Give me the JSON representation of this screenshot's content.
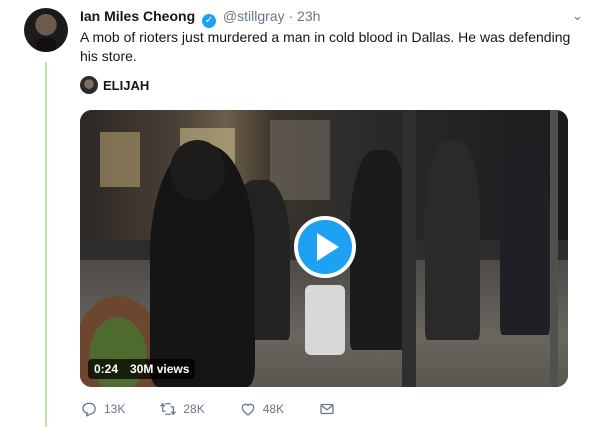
{
  "tweet": {
    "author_name": "Ian Miles Cheong",
    "handle": "@stillgray",
    "separator": "·",
    "time": "23h",
    "text": "A mob of rioters just murdered a man  in cold blood in Dallas. He was defending his store.",
    "attribution_name": "ELIJAH",
    "video": {
      "duration": "0:24",
      "views": "30M views"
    },
    "actions": {
      "reply_count": "13K",
      "retweet_count": "28K",
      "like_count": "48K"
    }
  },
  "icons": {
    "verified": "verified-badge-icon",
    "more": "chevron-down-icon",
    "play": "play-icon",
    "reply": "reply-icon",
    "retweet": "retweet-icon",
    "like": "heart-icon",
    "dm": "envelope-icon"
  },
  "colors": {
    "accent": "#1da1f2",
    "muted": "#657786",
    "thread_line": "#c3e6a4"
  }
}
